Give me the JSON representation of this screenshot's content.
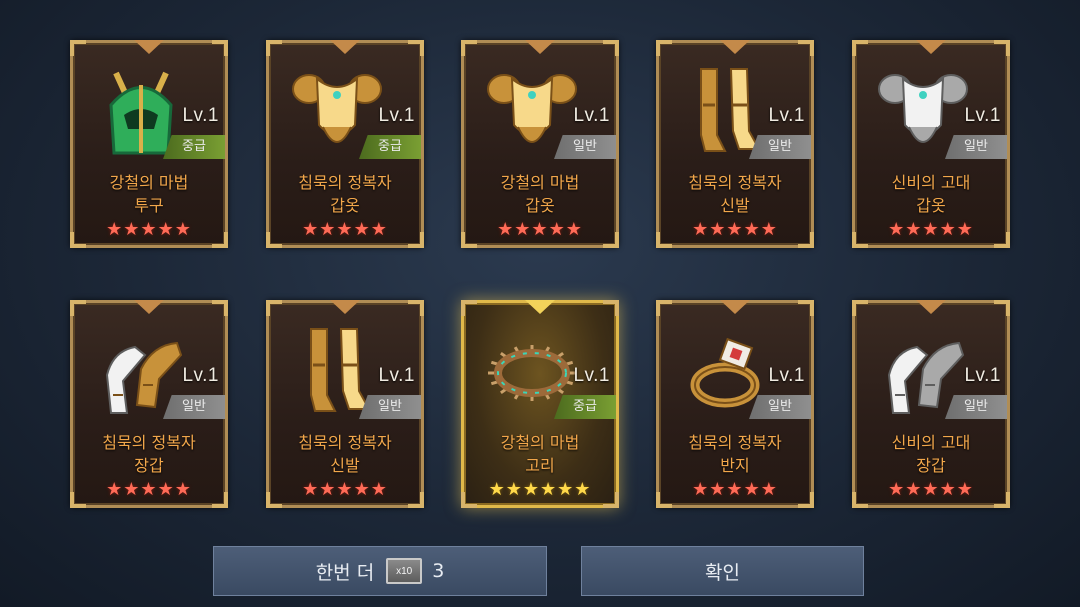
{
  "cards": [
    {
      "level": "Lv.1",
      "grade": "중급",
      "grade_class": "mid",
      "name_line1": "강철의 마법",
      "name_line2": "투구",
      "stars": "★★★★★",
      "icon": "green-helmet-icon",
      "highlight": false
    },
    {
      "level": "Lv.1",
      "grade": "중급",
      "grade_class": "mid",
      "name_line1": "침묵의 정복자",
      "name_line2": "갑옷",
      "stars": "★★★★★",
      "icon": "gold-armor-icon",
      "highlight": false
    },
    {
      "level": "Lv.1",
      "grade": "일반",
      "grade_class": "normal",
      "name_line1": "강철의 마법",
      "name_line2": "갑옷",
      "stars": "★★★★★",
      "icon": "gold-armor-icon",
      "highlight": false
    },
    {
      "level": "Lv.1",
      "grade": "일반",
      "grade_class": "normal",
      "name_line1": "침묵의 정복자",
      "name_line2": "신발",
      "stars": "★★★★★",
      "icon": "gold-boots-icon",
      "highlight": false
    },
    {
      "level": "Lv.1",
      "grade": "일반",
      "grade_class": "normal",
      "name_line1": "신비의 고대",
      "name_line2": "갑옷",
      "stars": "★★★★★",
      "icon": "silver-armor-icon",
      "highlight": false
    },
    {
      "level": "Lv.1",
      "grade": "일반",
      "grade_class": "normal",
      "name_line1": "침묵의 정복자",
      "name_line2": "장갑",
      "stars": "★★★★★",
      "icon": "gold-gloves-icon",
      "highlight": false
    },
    {
      "level": "Lv.1",
      "grade": "일반",
      "grade_class": "normal",
      "name_line1": "침묵의 정복자",
      "name_line2": "신발",
      "stars": "★★★★★",
      "icon": "gold-boots-icon",
      "highlight": false
    },
    {
      "level": "Lv.1",
      "grade": "중급",
      "grade_class": "mid",
      "name_line1": "강철의 마법",
      "name_line2": "고리",
      "stars": "★★★★★★",
      "icon": "spiked-ring-icon",
      "highlight": true
    },
    {
      "level": "Lv.1",
      "grade": "일반",
      "grade_class": "normal",
      "name_line1": "침묵의 정복자",
      "name_line2": "반지",
      "stars": "★★★★★",
      "icon": "gem-ring-icon",
      "highlight": false
    },
    {
      "level": "Lv.1",
      "grade": "일반",
      "grade_class": "normal",
      "name_line1": "신비의 고대",
      "name_line2": "장갑",
      "stars": "★★★★★",
      "icon": "silver-gloves-icon",
      "highlight": false
    }
  ],
  "buttons": {
    "again_label": "한번 더",
    "ticket_label": "x10",
    "again_count": "3",
    "confirm_label": "확인"
  }
}
